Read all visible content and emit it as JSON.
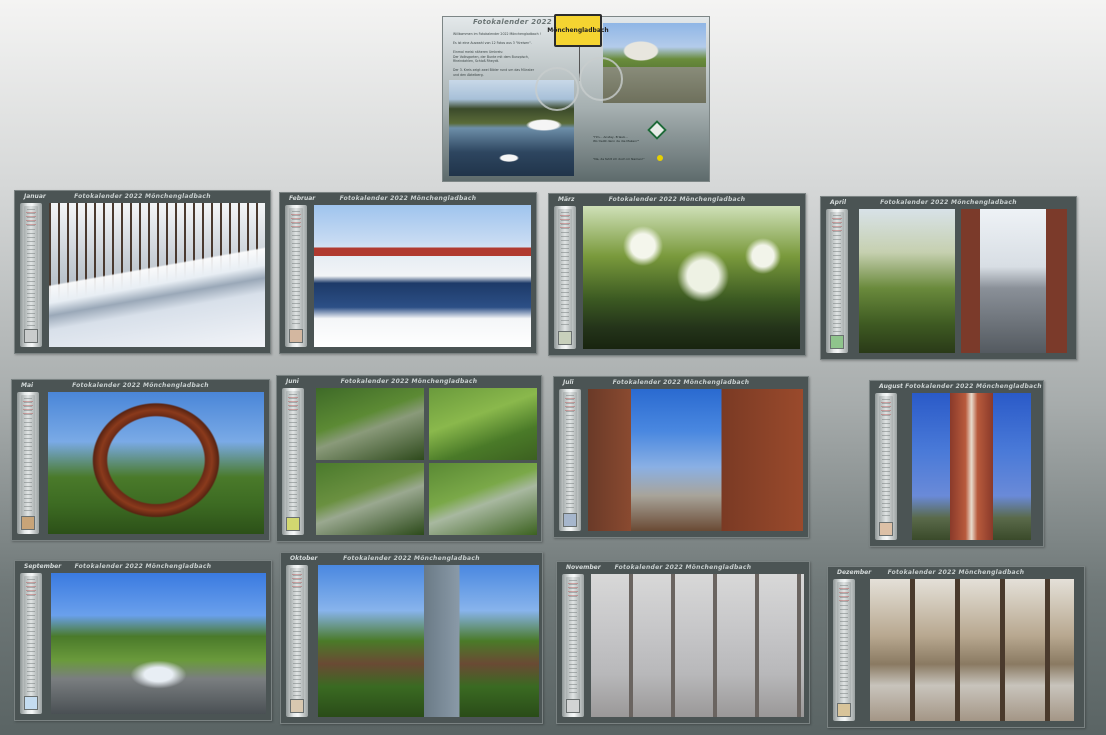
{
  "cover": {
    "title": "Fotokalender 2022",
    "sign_text": "Mönchengladbach",
    "intro_lines": [
      "Willkommen im Fotokalender 2022 Mönchengladbach !",
      "",
      "Es ist eine Auswahl von 12 Fotos aus 3 \"Kreisen\".",
      "",
      "Einmal meist näheren Umkreis:",
      "Der Volksgarten, der Bunte mit dem Bunzpisch,",
      "Rheindahlen, Schloß Rheydt.",
      "",
      "Der 3. Kreis zeigt zwei Bilder rund um das Münster",
      "und den Abteiberg.",
      "",
      "Aber seht selbst: durchblättern."
    ],
    "quote_lines": [
      "\"Hm... Anstay, Erlaub...",
      "Wo treibt denn da die Maken?\""
    ],
    "quote2": "\"Na, da fehlt ich doch im Namen!\""
  },
  "calendar_header": "Fotokalender 2022  Mönchengladbach",
  "months": [
    {
      "name": "Januar",
      "swatch": "#c9cccc"
    },
    {
      "name": "Februar",
      "swatch": "#d3b7a0"
    },
    {
      "name": "März",
      "swatch": "#c8d0bc"
    },
    {
      "name": "April",
      "swatch": "#8fc48c"
    },
    {
      "name": "Mai",
      "swatch": "#c8a478"
    },
    {
      "name": "Juni",
      "swatch": "#d2d870"
    },
    {
      "name": "Juli",
      "swatch": "#a6b6cc"
    },
    {
      "name": "August",
      "swatch": "#dcc0a6"
    },
    {
      "name": "September",
      "swatch": "#c4dcf0"
    },
    {
      "name": "Oktober",
      "swatch": "#d8c8b0"
    },
    {
      "name": "November",
      "swatch": "#d2d4d4"
    },
    {
      "name": "Dezember",
      "swatch": "#d8c49a"
    }
  ]
}
